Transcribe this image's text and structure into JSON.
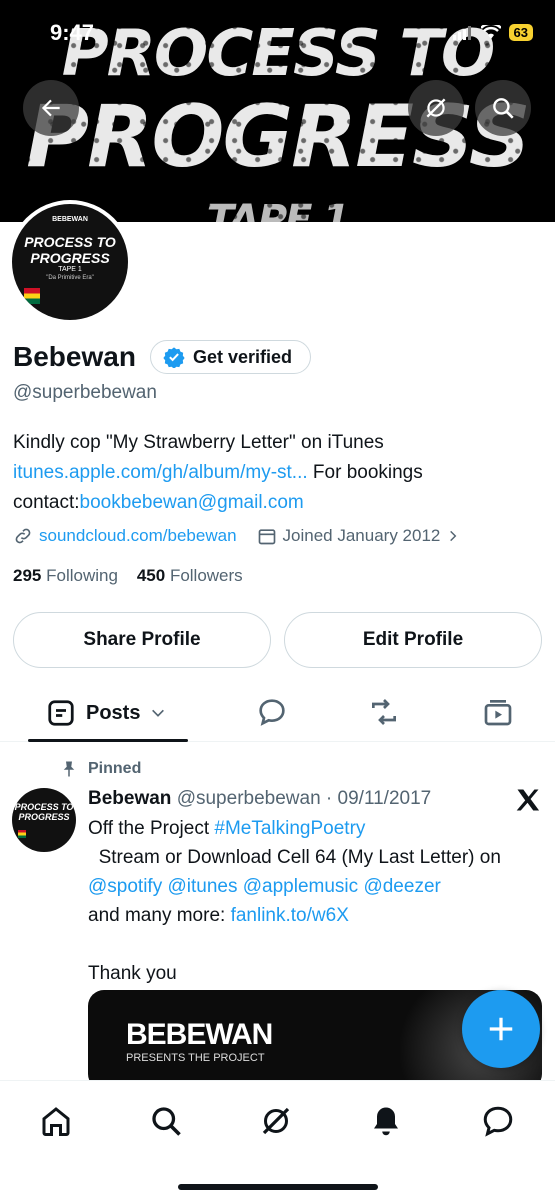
{
  "status_bar": {
    "time": "9:47",
    "battery": "63"
  },
  "banner": {
    "line1": "PROCESS TO",
    "line2": "PROGRESS",
    "line3": "TAPE 1"
  },
  "avatar": {
    "small": "BEBEWAN",
    "title": "PROCESS TO PROGRESS",
    "tape": "TAPE 1",
    "sub": "\"Da Primitive Era\""
  },
  "profile": {
    "name": "Bebewan",
    "verify_label": "Get verified",
    "handle": "@superbebewan",
    "bio_text": "Kindly cop \"My Strawberry Letter\" on iTunes",
    "bio_link": "itunes.apple.com/gh/album/my-st...",
    "bio_text2": " For bookings contact:",
    "bio_email": "bookbebewan@gmail.com",
    "website": "soundcloud.com/bebewan",
    "joined": "Joined January 2012",
    "following_count": "295",
    "following_label": "Following",
    "followers_count": "450",
    "followers_label": "Followers"
  },
  "buttons": {
    "share": "Share Profile",
    "edit": "Edit Profile"
  },
  "tabs": {
    "posts": "Posts"
  },
  "post": {
    "pinned_label": "Pinned",
    "avatar_title": "PROCESS TO PROGRESS",
    "name": "Bebewan",
    "handle_date": "@superbebewan · 09/11/2017",
    "body_1": "Off the Project ",
    "hashtag": "#MeTalkingPoetry",
    "body_2": "\n  Stream or Download Cell 64 (My Last Letter) on ",
    "mention_1": "@spotify",
    "mention_2": "@itunes",
    "mention_3": "@applemusic",
    "mention_4": "@deezer",
    "body_3": "\nand many more: ",
    "post_link": "fanlink.to/w6X",
    "body_4": "\n\nThank you",
    "media_title": "BEBEWAN",
    "media_sub": "PRESENTS THE PROJECT"
  },
  "icons": [
    "back-arrow-icon",
    "grok-icon",
    "search-icon",
    "verified-badge-icon",
    "link-icon",
    "calendar-icon",
    "chevron-right-icon",
    "posts-icon",
    "chevron-down-icon",
    "reply-icon",
    "repost-icon",
    "media-icon",
    "pin-icon",
    "x-logo-icon",
    "plus-icon",
    "home-icon",
    "search-nav-icon",
    "grok-nav-icon",
    "notifications-icon",
    "messages-icon"
  ],
  "colors": {
    "accent": "#1d9bf0",
    "text": "#0f1419",
    "muted": "#536471",
    "battery": "#f7d130"
  }
}
